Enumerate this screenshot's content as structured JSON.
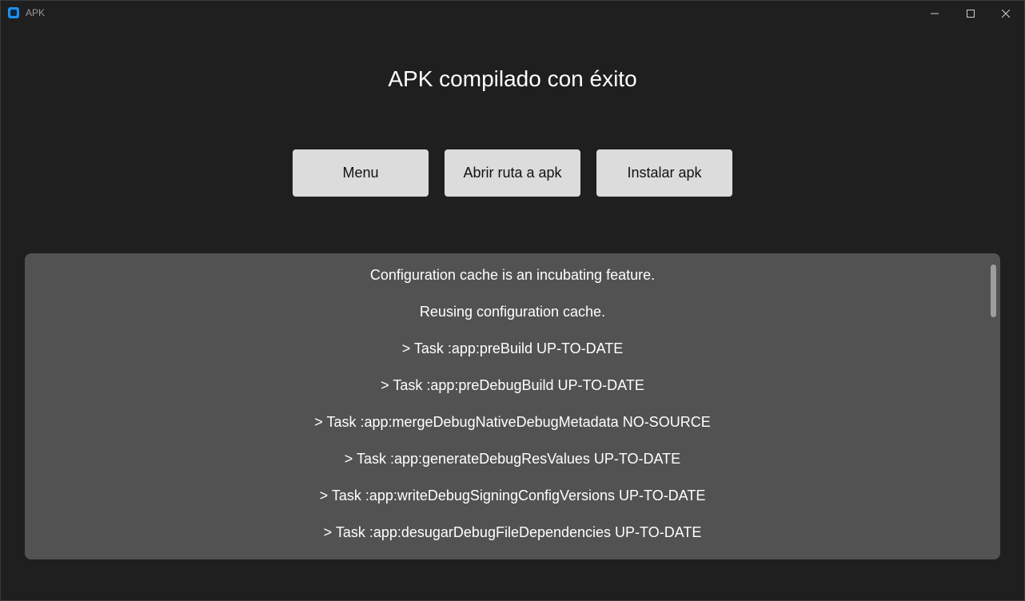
{
  "window": {
    "title": "APK"
  },
  "main": {
    "heading": "APK compilado con éxito"
  },
  "actions": {
    "menu_label": "Menu",
    "open_path_label": "Abrir ruta a apk",
    "install_label": "Instalar apk"
  },
  "log": {
    "lines": [
      "Configuration cache is an incubating feature.",
      "Reusing configuration cache.",
      "> Task :app:preBuild UP-TO-DATE",
      "> Task :app:preDebugBuild UP-TO-DATE",
      "> Task :app:mergeDebugNativeDebugMetadata NO-SOURCE",
      "> Task :app:generateDebugResValues UP-TO-DATE",
      "> Task :app:writeDebugSigningConfigVersions UP-TO-DATE",
      "> Task :app:desugarDebugFileDependencies UP-TO-DATE"
    ]
  },
  "icons": {
    "app": "app-icon",
    "minimize": "minimize-icon",
    "maximize": "maximize-icon",
    "close": "close-icon"
  },
  "colors": {
    "background": "#1f1f1f",
    "button": "#dcdcdc",
    "log_panel": "#525252",
    "app_icon": "#1d8ff0"
  }
}
